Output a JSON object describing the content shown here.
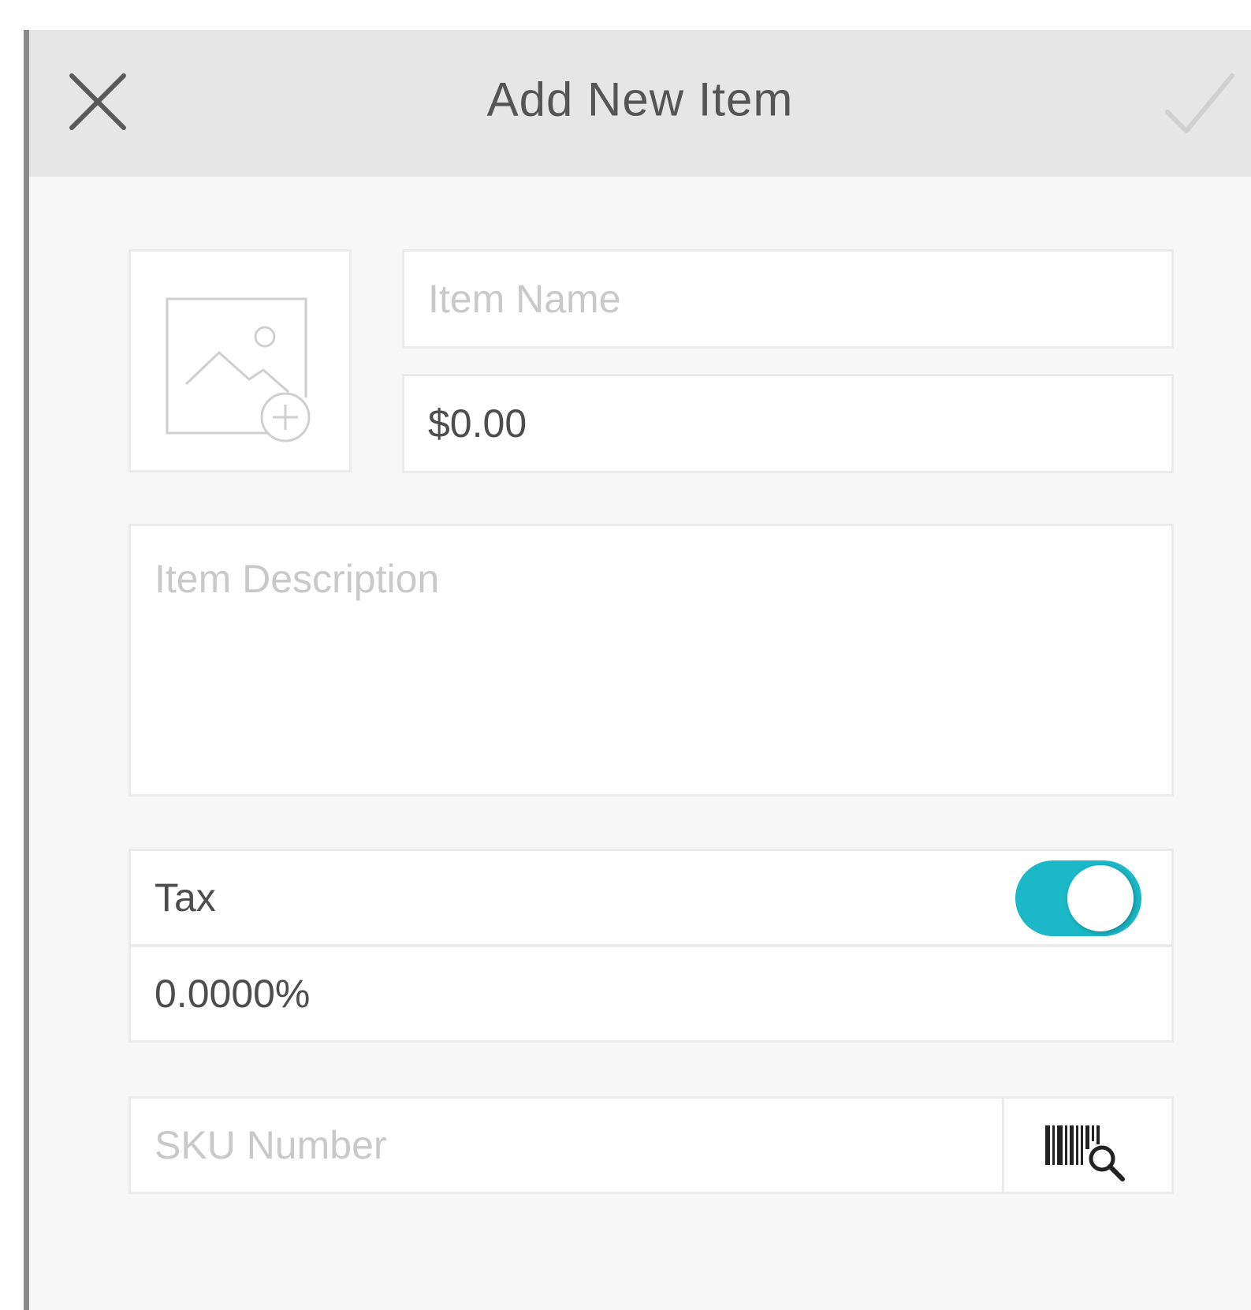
{
  "header": {
    "title": "Add New Item"
  },
  "icons": {
    "close": "close-icon",
    "confirm": "checkmark-icon",
    "photo": "add-photo-icon",
    "barcode": "barcode-scan-icon"
  },
  "form": {
    "item_name": {
      "placeholder": "Item Name",
      "value": ""
    },
    "price": {
      "value": "$0.00"
    },
    "description": {
      "placeholder": "Item Description",
      "value": ""
    },
    "tax": {
      "label": "Tax",
      "enabled": true
    },
    "tax_rate": {
      "value": "0.0000%"
    },
    "sku": {
      "placeholder": "SKU Number",
      "value": ""
    }
  },
  "colors": {
    "accent": "#1bb8c7",
    "header_bg": "#e6e6e6",
    "page_bg": "#f7f7f7"
  }
}
